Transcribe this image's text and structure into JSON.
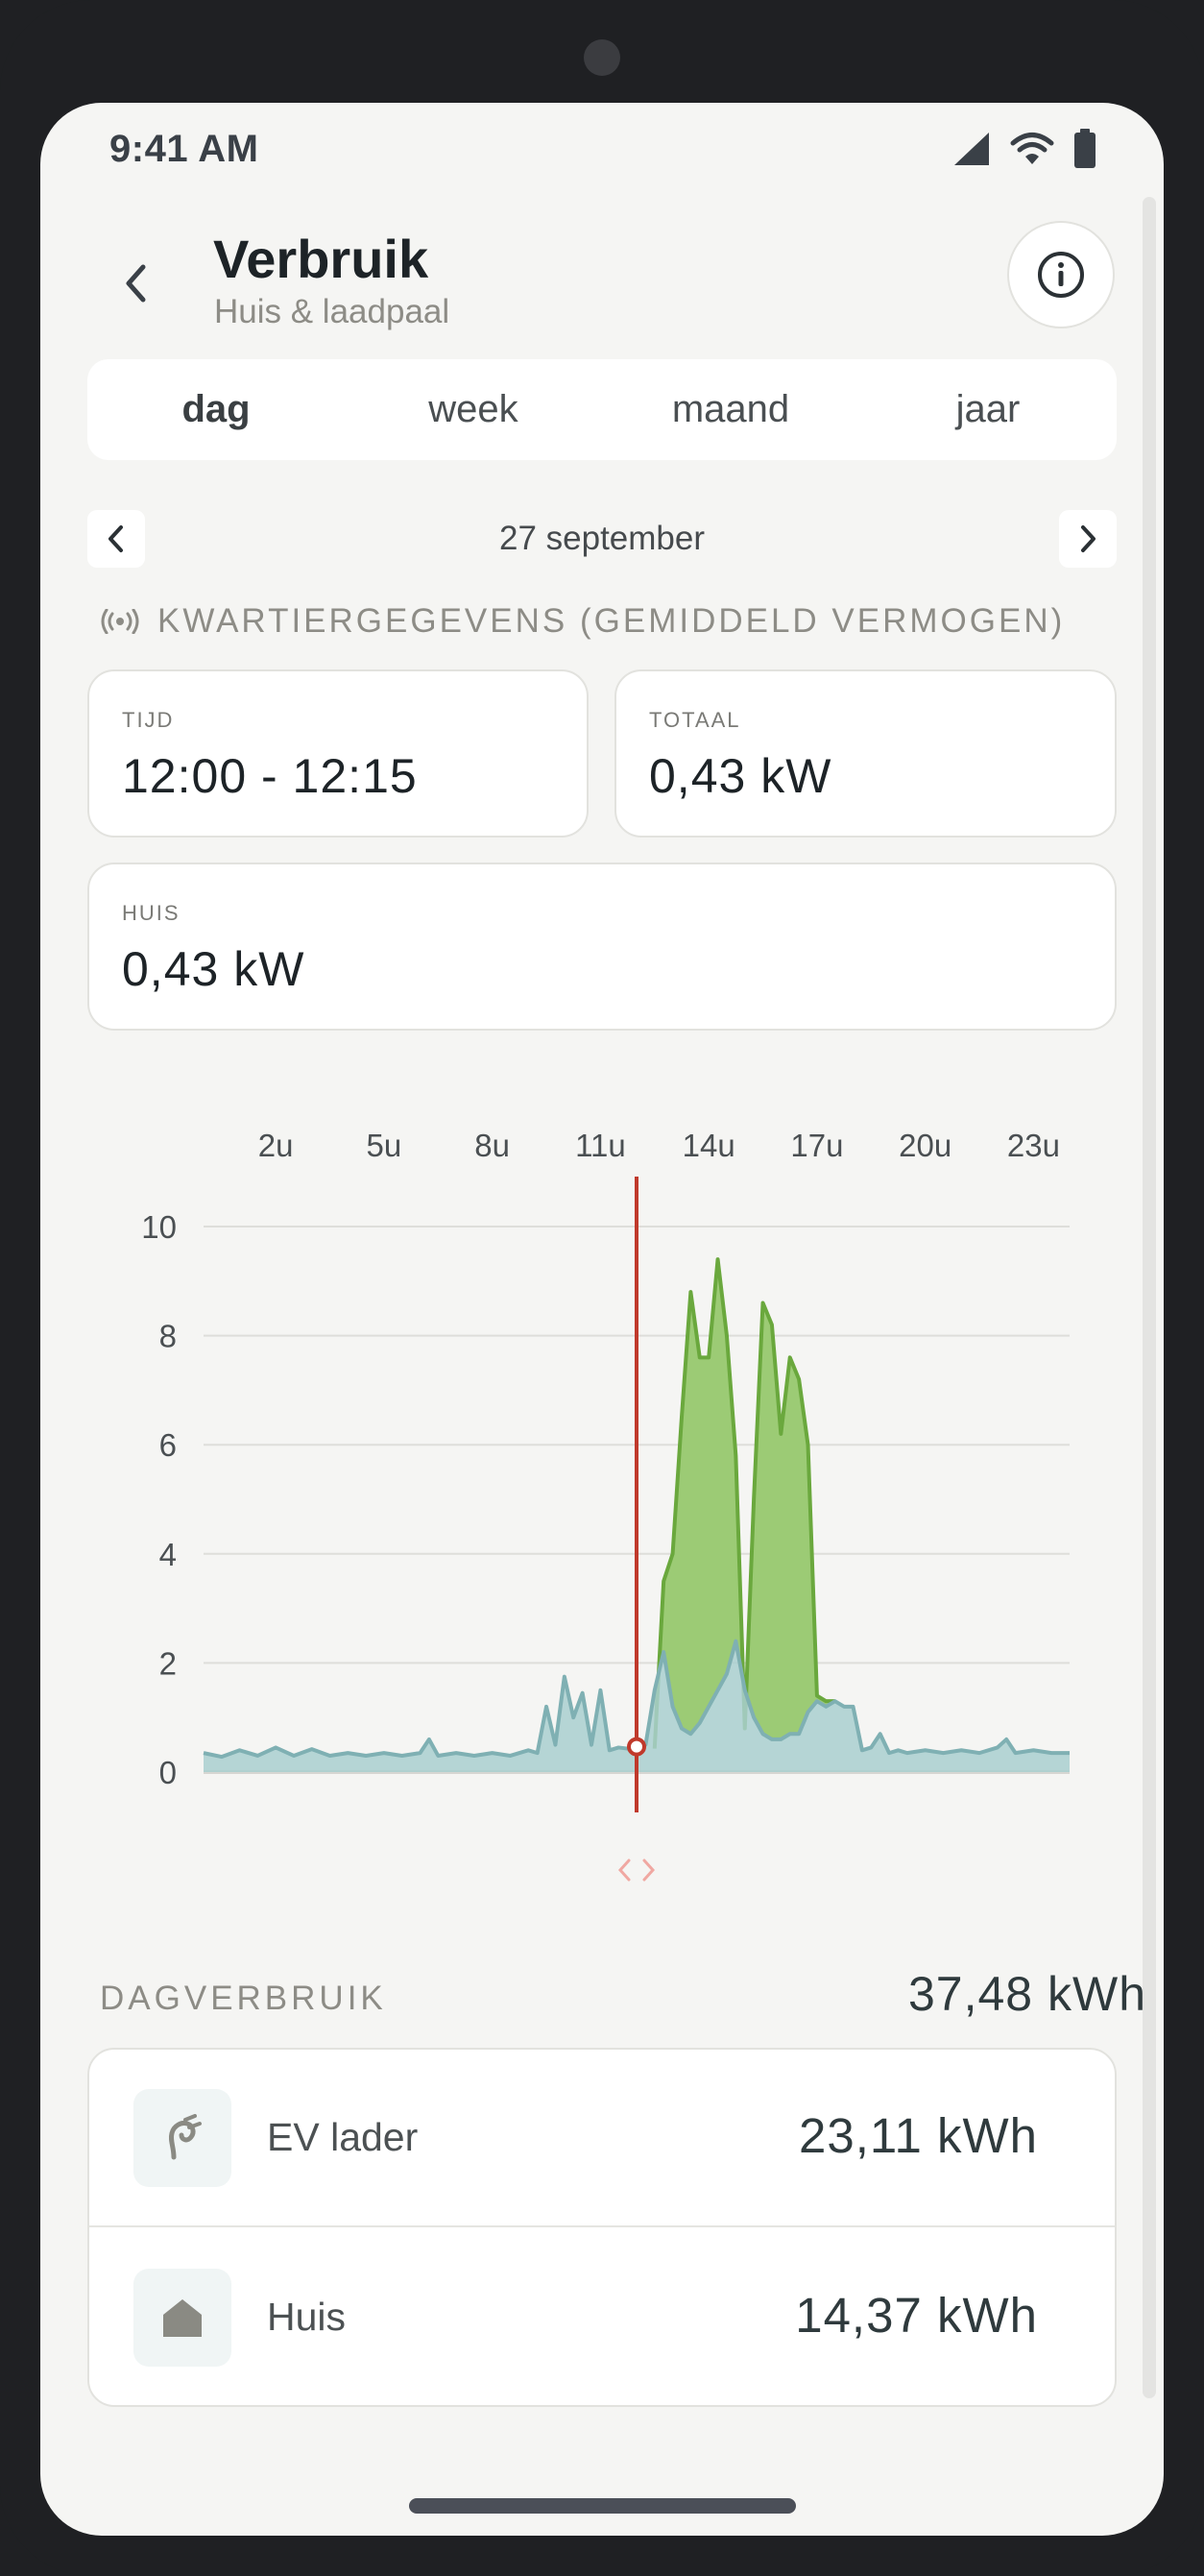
{
  "status_bar": {
    "time": "9:41 AM",
    "icons": [
      "signal-icon",
      "wifi-icon",
      "battery-icon"
    ]
  },
  "header": {
    "title": "Verbruik",
    "subtitle": "Huis & laadpaal",
    "back_icon": "chevron-left-icon",
    "info_icon": "info-icon"
  },
  "tabs": [
    {
      "label": "dag",
      "active": true
    },
    {
      "label": "week",
      "active": false
    },
    {
      "label": "maand",
      "active": false
    },
    {
      "label": "jaar",
      "active": false
    }
  ],
  "date_nav": {
    "date": "27 september",
    "prev_icon": "chevron-left-icon",
    "next_icon": "chevron-right-icon"
  },
  "quarter": {
    "label": "KWARTIERGEGEVENS (GEMIDDELD VERMOGEN)",
    "icon": "broadcast-icon"
  },
  "readout": {
    "tijd": {
      "label": "TIJD",
      "value": "12:00 - 12:15"
    },
    "totaal": {
      "label": "TOTAAL",
      "value": "0,43 kW"
    },
    "huis": {
      "label": "HUIS",
      "value": "0,43 kW"
    }
  },
  "chart_data": {
    "type": "area",
    "x_ticks": [
      "2u",
      "5u",
      "8u",
      "11u",
      "14u",
      "17u",
      "20u",
      "23u"
    ],
    "x_tick_hours": [
      2,
      5,
      8,
      11,
      14,
      17,
      20,
      23
    ],
    "y_ticks": [
      "10",
      "8",
      "6",
      "4",
      "2",
      "0"
    ],
    "ylim": [
      0,
      10
    ],
    "xlim": [
      0,
      24
    ],
    "grid": true,
    "stacked": true,
    "cursor_hour": 12.0,
    "cursor_icon": "drag-handle-icon",
    "colors": {
      "huis": "#a9cfcf",
      "huis_line": "#7fb0b3",
      "ev": "#9ccb75",
      "ev_line": "#6aa83d",
      "cursor": "#c0392b"
    },
    "series": [
      {
        "key": "huis",
        "hours": [
          0,
          0.5,
          1,
          1.5,
          2,
          2.5,
          3,
          3.5,
          4,
          4.5,
          5,
          5.5,
          6,
          6.25,
          6.5,
          7,
          7.5,
          8,
          8.5,
          9,
          9.25,
          9.5,
          9.75,
          10,
          10.25,
          10.5,
          10.75,
          11,
          11.25,
          11.5,
          11.75,
          12,
          12.25,
          12.5,
          12.75,
          13,
          13.25,
          13.5,
          13.75,
          14,
          14.25,
          14.5,
          14.75,
          15,
          15.25,
          15.5,
          15.75,
          16,
          16.25,
          16.5,
          16.75,
          17,
          17.25,
          17.5,
          17.75,
          18,
          18.25,
          18.5,
          18.75,
          19,
          19.25,
          19.5,
          20,
          20.5,
          21,
          21.5,
          22,
          22.25,
          22.5,
          23,
          23.5,
          24
        ],
        "kw": [
          0.35,
          0.28,
          0.4,
          0.3,
          0.45,
          0.3,
          0.42,
          0.3,
          0.35,
          0.3,
          0.35,
          0.3,
          0.35,
          0.6,
          0.3,
          0.35,
          0.3,
          0.35,
          0.3,
          0.4,
          0.35,
          1.2,
          0.5,
          1.75,
          1.0,
          1.45,
          0.5,
          1.5,
          0.4,
          0.45,
          0.43,
          0.43,
          0.5,
          1.5,
          2.2,
          1.2,
          0.8,
          0.7,
          0.9,
          1.2,
          1.5,
          1.8,
          2.4,
          1.5,
          1.0,
          0.7,
          0.6,
          0.6,
          0.7,
          0.7,
          1.1,
          1.3,
          1.2,
          1.3,
          1.2,
          1.2,
          0.4,
          0.45,
          0.7,
          0.35,
          0.4,
          0.35,
          0.4,
          0.35,
          0.4,
          0.35,
          0.45,
          0.6,
          0.35,
          0.4,
          0.35,
          0.35
        ]
      },
      {
        "key": "ev",
        "hours": [
          12.5,
          12.75,
          13,
          13.25,
          13.5,
          13.75,
          14,
          14.25,
          14.5,
          14.75,
          15,
          15.25,
          15.5,
          15.75,
          16,
          16.25,
          16.5,
          16.75,
          17,
          17.25,
          17.5
        ],
        "total_kw": [
          0.43,
          3.5,
          4.0,
          6.5,
          8.8,
          7.6,
          7.6,
          9.4,
          8.0,
          5.8,
          0.8,
          5.0,
          8.6,
          8.2,
          6.2,
          7.6,
          7.2,
          6.0,
          1.4,
          1.3,
          1.3
        ]
      }
    ]
  },
  "day": {
    "label": "DAGVERBRUIK",
    "total": "37,48 kWh"
  },
  "items": [
    {
      "icon": "ev-plug-icon",
      "name": "EV lader",
      "value": "23,11 kWh"
    },
    {
      "icon": "house-icon",
      "name": "Huis",
      "value": "14,37 kWh"
    }
  ]
}
